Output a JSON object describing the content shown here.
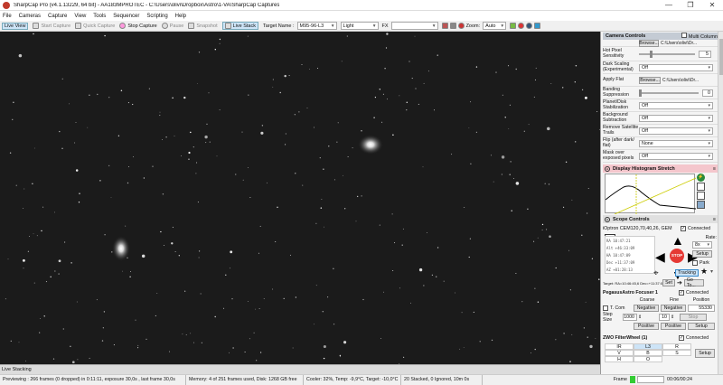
{
  "window": {
    "title": "SharpCap Pro (v4.1.13229, 64 bit) - AA183MPROTEC - C:\\Users\\olivi\\Dropbox\\Astro\\1-VA\\SharpCap Captures",
    "min": "—",
    "max": "❐",
    "close": "✕"
  },
  "menu": [
    "File",
    "Cameras",
    "Capture",
    "View",
    "Tools",
    "Sequencer",
    "Scripting",
    "Help"
  ],
  "toolbar": {
    "live_view": "Live View",
    "start_capture": "Start Capture",
    "quick_capture": "Quick Capture",
    "stop_capture": "Stop Capture",
    "pause": "Pause",
    "snapshot": "Snapshot",
    "live_stack": "Live Stack",
    "target_label": "Target Name :",
    "target_value": "M95-96-L3",
    "frame_type": "Light",
    "fx_label": "FX",
    "fx_value": "",
    "zoom_label": "Zoom:",
    "zoom_value": "Auto"
  },
  "live_stacking_label": "Live Stacking",
  "status": {
    "preview": "Previewing : 266 frames (0 dropped) in 0:11:11, exposure 30,0s , last frame 30,0s",
    "memory": "Memory: 4 of 251 frames used, Disk: 1268 GB free",
    "cooler": "Cooler: 32%, Temp: -9,9°C, Target: -10,0°C",
    "stacked": "20 Stacked, 0 Ignored, 10m 0s",
    "frame_label": "Frame",
    "time": "00:06/00:24"
  },
  "camera_controls": {
    "title": "Camera Controls",
    "multi_column": "Multi Column",
    "browse": "Browse...",
    "path_top": "C:\\Users\\olivi\\Dr...",
    "rows": [
      {
        "label": "Hot Pixel Sensitivity",
        "value": "5"
      },
      {
        "label": "Dark Scaling (Experimental)",
        "value": "Off"
      },
      {
        "label": "Apply Flat",
        "browse": "Browse...",
        "value": "C:\\Users\\olivi\\Dr..."
      },
      {
        "label": "Banding Suppression",
        "value": "0"
      },
      {
        "label": "Planet/Disk Stabilization",
        "value": "Off"
      },
      {
        "label": "Background Subtraction",
        "value": "Off"
      },
      {
        "label": "Remove Satellite Trails",
        "value": "Off"
      },
      {
        "label": "Flip (after dark/ flat)",
        "value": "None"
      },
      {
        "label": "Mask over exposed pixels",
        "value": "Off"
      }
    ]
  },
  "histogram": {
    "title": "Display Histogram Stretch"
  },
  "scope": {
    "title": "Scope Controls",
    "mount": "iOptron CEM120,70,40,26, GEM",
    "connected": "Connected",
    "rate_label": "Rate:",
    "rate_value": "8x",
    "setup": "Setup",
    "park": "Park",
    "tracking": "Tracking",
    "stop": "STOP",
    "set": "Set",
    "goto": "Go To...",
    "target": "Target: RA=10:46:45,6 Dec=+11:37:09",
    "lcd": [
      {
        "k": "RA",
        "v": "10:47:21"
      },
      {
        "k": "Alt",
        "v": "+46:33:09"
      },
      {
        "k": "HA",
        "v": "10:47:09"
      },
      {
        "k": "Dec",
        "v": "+11:37:09"
      },
      {
        "k": "AZ",
        "v": "+01:28:13"
      }
    ]
  },
  "focuser": {
    "title": "PegasusAstro Focuser 1",
    "connected": "Connected",
    "coarse": "Coarse",
    "fine": "Fine",
    "position": "Position",
    "tcomp": "T. Com",
    "negative": "Negative",
    "positive": "Positive",
    "pos_value": "55330",
    "stop": "Stop",
    "step_label": "Step Size",
    "step_coarse": "1000",
    "step_fine": "10",
    "setup": "Setup"
  },
  "filterwheel": {
    "title": "ZWO FilterWheel (1)",
    "connected": "Connected",
    "filters": [
      "IR",
      "L3",
      "R",
      "V",
      "B",
      "S",
      "H",
      "O"
    ],
    "selected": "L3",
    "setup": "Setup"
  }
}
